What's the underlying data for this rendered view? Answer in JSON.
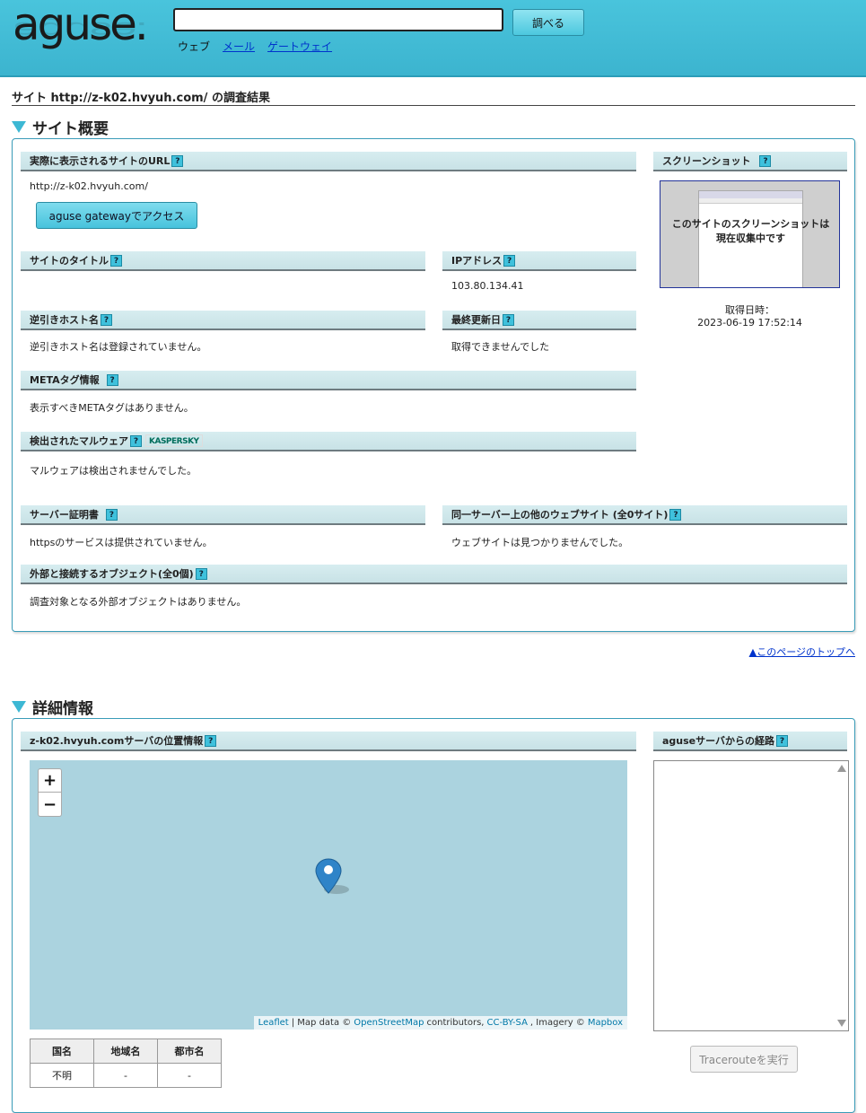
{
  "header": {
    "logo_text": "aguse.",
    "search_value": "",
    "search_button": "調べる",
    "nav": [
      {
        "label": "ウェブ",
        "link": false
      },
      {
        "label": "メール",
        "link": true
      },
      {
        "label": "ゲートウェイ",
        "link": true
      }
    ]
  },
  "result_title": "サイト http://z-k02.hvyuh.com/ の調査結果",
  "overview": {
    "heading": "サイト概要",
    "url_label": "実際に表示されるサイトのURL",
    "url_value": "http://z-k02.hvyuh.com/",
    "gateway_button": "aguse gatewayでアクセス",
    "screenshot_label": "スクリーンショット",
    "screenshot_message_1": "このサイトのスクリーンショットは",
    "screenshot_message_2": "現在収集中です",
    "screenshot_date_label": "取得日時：",
    "screenshot_date": "2023-06-19 17:52:14",
    "title_label": "サイトのタイトル",
    "title_value": "",
    "ip_label": "IPアドレス",
    "ip_value": "103.80.134.41",
    "reverse_label": "逆引きホスト名",
    "reverse_value": "逆引きホスト名は登録されていません。",
    "updated_label": "最終更新日",
    "updated_value": "取得できませんでした",
    "meta_label": "METAタグ情報",
    "meta_value": "表示すべきMETAタグはありません。",
    "malware_label": "検出されたマルウェア",
    "malware_logo": "KASPERSKY",
    "malware_value": "マルウェアは検出されませんでした。",
    "cert_label": "サーバー証明書",
    "cert_value": "httpsのサービスは提供されていません。",
    "same_server_label": "同一サーバー上の他のウェブサイト (全0サイト)",
    "same_server_value": "ウェブサイトは見つかりませんでした。",
    "external_label": "外部と接続するオブジェクト(全0個)",
    "external_value": "調査対象となる外部オブジェクトはありません。",
    "help_mark": "?"
  },
  "top_link": "▲このページのトップへ",
  "details": {
    "heading": "詳細情報",
    "location_label": "z-k02.hvyuh.comサーバの位置情報",
    "route_label": "aguseサーバからの経路",
    "zoom_in": "+",
    "zoom_out": "−",
    "attribution": {
      "leaflet": "Leaflet",
      "sep": "| Map data ©",
      "osm": "OpenStreetMap",
      "contributors": "contributors,",
      "license": "CC-BY-SA",
      "imagery": ", Imagery ©",
      "mapbox": "Mapbox"
    },
    "geo_headers": [
      "国名",
      "地域名",
      "都市名"
    ],
    "geo_values": [
      "不明",
      "-",
      "-"
    ],
    "traceroute_button": "Tracerouteを実行"
  }
}
